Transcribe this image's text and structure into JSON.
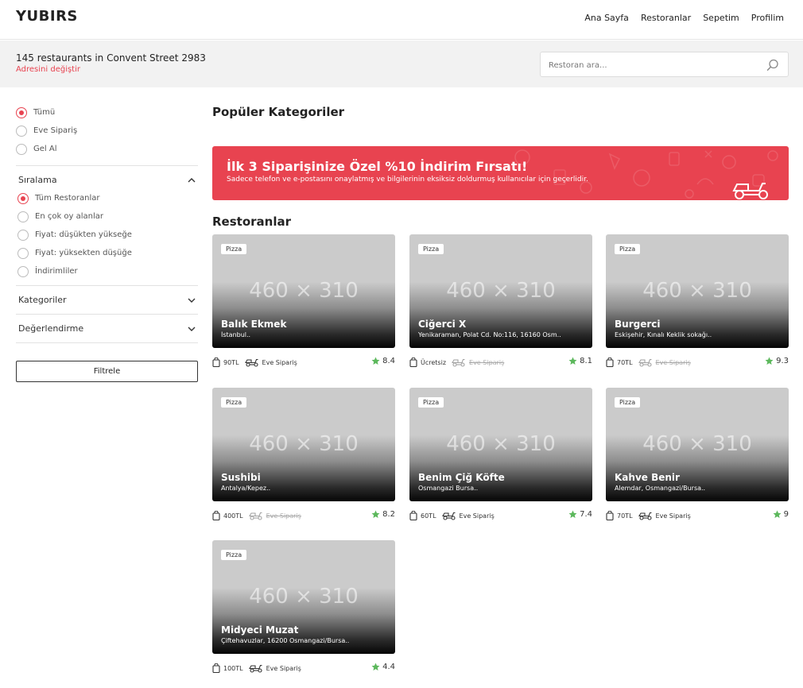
{
  "header": {
    "logo": "YUBIRS",
    "nav": [
      "Ana Sayfa",
      "Restoranlar",
      "Sepetim",
      "Profilim"
    ]
  },
  "subbar": {
    "title": "145 restaurants in Convent Street 2983",
    "change_address": "Adresini değiştir",
    "search_placeholder": "Restoran ara..."
  },
  "sidebar": {
    "order_types": [
      {
        "label": "Tümü",
        "selected": true
      },
      {
        "label": "Eve Sipariş",
        "selected": false
      },
      {
        "label": "Gel Al",
        "selected": false
      }
    ],
    "sort_title": "Sıralama",
    "sort_options": [
      {
        "label": "Tüm Restoranlar",
        "selected": true
      },
      {
        "label": "En çok oy alanlar",
        "selected": false
      },
      {
        "label": "Fiyat: düşükten yükseğe",
        "selected": false
      },
      {
        "label": "Fiyat: yüksekten düşüğe",
        "selected": false
      },
      {
        "label": "İndirimliler",
        "selected": false
      }
    ],
    "categories_title": "Kategoriler",
    "rating_title": "Değerlendirme",
    "filter_button": "Filtrele"
  },
  "main": {
    "popular_heading": "Popüler Kategoriler",
    "banner": {
      "title": "İlk 3 Siparişinize Özel %10 İndirim Fırsatı!",
      "subtitle": "Sadece telefon ve e-postasını onaylatmış ve bilgilerinin eksiksiz doldurmuş kullanıcılar için geçerlidir.",
      "color": "#e84350"
    },
    "restaurants_heading": "Restoranlar",
    "restaurants": [
      {
        "tag": "Pizza",
        "placeholder": "460 × 310",
        "name": "Balık Ekmek",
        "address": "İstanbul..",
        "price": "90TL",
        "delivery": "Eve Sipariş",
        "delivery_available": true,
        "rating": "8.4"
      },
      {
        "tag": "Pizza",
        "placeholder": "460 × 310",
        "name": "Ciğerci X",
        "address": "Yenikaraman, Polat Cd. No:116, 16160 Osm..",
        "price": "Ücretsiz",
        "delivery": "Eve Sipariş",
        "delivery_available": false,
        "rating": "8.1"
      },
      {
        "tag": "Pizza",
        "placeholder": "460 × 310",
        "name": "Burgerci",
        "address": "Eskişehir, Kınalı Keklik sokağı..",
        "price": "70TL",
        "delivery": "Eve Sipariş",
        "delivery_available": false,
        "rating": "9.3"
      },
      {
        "tag": "Pizza",
        "placeholder": "460 × 310",
        "name": "Sushibi",
        "address": "Antalya/Kepez..",
        "price": "400TL",
        "delivery": "Eve Sipariş",
        "delivery_available": false,
        "rating": "8.2"
      },
      {
        "tag": "Pizza",
        "placeholder": "460 × 310",
        "name": "Benim Çiğ Köfte",
        "address": "Osmangazi Bursa..",
        "price": "60TL",
        "delivery": "Eve Sipariş",
        "delivery_available": true,
        "rating": "7.4"
      },
      {
        "tag": "Pizza",
        "placeholder": "460 × 310",
        "name": "Kahve Benir",
        "address": "Alemdar, Osmangazi/Bursa..",
        "price": "70TL",
        "delivery": "Eve Sipariş",
        "delivery_available": true,
        "rating": "9"
      },
      {
        "tag": "Pizza",
        "placeholder": "460 × 310",
        "name": "Midyeci Muzat",
        "address": "Çiftehavuzlar, 16200 Osmangazi/Bursa..",
        "price": "100TL",
        "delivery": "Eve Sipariş",
        "delivery_available": true,
        "rating": "4.4"
      }
    ]
  },
  "colors": {
    "accent": "#e84350",
    "star": "#5cb85c"
  },
  "icons": [
    "search-icon",
    "chevron-up-icon",
    "chevron-down-icon",
    "bag-icon",
    "scooter-icon",
    "star-icon"
  ]
}
